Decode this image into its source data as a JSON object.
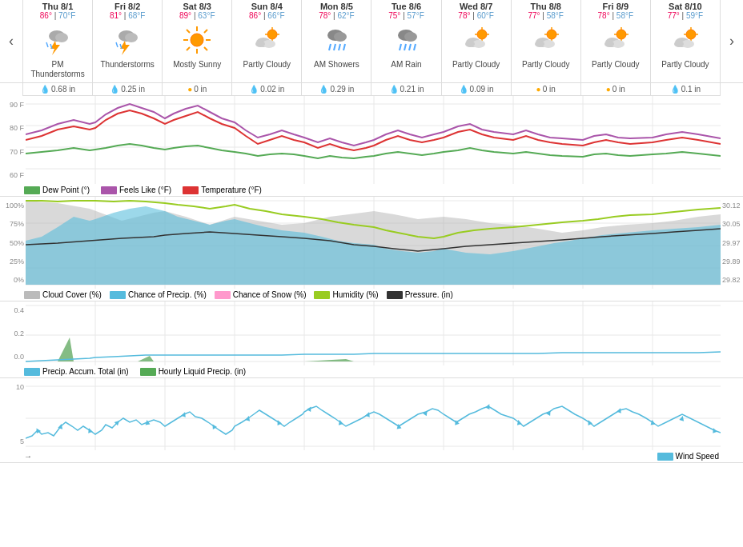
{
  "days": [
    {
      "name": "Thu 8/1",
      "high": "86°",
      "low": "70°F",
      "desc": "PM Thunderstorms",
      "icon": "thunder",
      "precip": "0.68 in",
      "precipType": "rain"
    },
    {
      "name": "Fri 8/2",
      "high": "81°",
      "low": "68°F",
      "desc": "Thunderstorms",
      "icon": "thunder",
      "precip": "0.25 in",
      "precipType": "rain"
    },
    {
      "name": "Sat 8/3",
      "high": "89°",
      "low": "63°F",
      "desc": "Mostly Sunny",
      "icon": "sun",
      "precip": "0 in",
      "precipType": "sun"
    },
    {
      "name": "Sun 8/4",
      "high": "86°",
      "low": "66°F",
      "desc": "Partly Cloudy",
      "icon": "cloud-sun",
      "precip": "0.02 in",
      "precipType": "rain"
    },
    {
      "name": "Mon 8/5",
      "high": "78°",
      "low": "62°F",
      "desc": "AM Showers",
      "icon": "rain",
      "precip": "0.29 in",
      "precipType": "rain"
    },
    {
      "name": "Tue 8/6",
      "high": "75°",
      "low": "57°F",
      "desc": "AM Rain",
      "icon": "rain",
      "precip": "0.21 in",
      "precipType": "rain"
    },
    {
      "name": "Wed 8/7",
      "high": "78°",
      "low": "60°F",
      "desc": "Partly Cloudy",
      "icon": "cloud-sun",
      "precip": "0.09 in",
      "precipType": "rain"
    },
    {
      "name": "Thu 8/8",
      "high": "77°",
      "low": "58°F",
      "desc": "Partly Cloudy",
      "icon": "cloud-sun",
      "precip": "0 in",
      "precipType": "sun"
    },
    {
      "name": "Fri 8/9",
      "high": "78°",
      "low": "58°F",
      "desc": "Partly Cloudy",
      "icon": "cloud-sun",
      "precip": "0 in",
      "precipType": "sun"
    },
    {
      "name": "Sat 8/10",
      "high": "77°",
      "low": "59°F",
      "desc": "Partly Cloudy",
      "icon": "cloud-sun",
      "precip": "0.1 in",
      "precipType": "rain"
    }
  ],
  "legends": {
    "temp": [
      {
        "label": "Dew Point (°)",
        "color": "#5a5"
      },
      {
        "label": "Feels Like (°F)",
        "color": "#a5a"
      },
      {
        "label": "Temperature (°F)",
        "color": "#d33"
      }
    ],
    "precip": [
      {
        "label": "Cloud Cover (%)",
        "color": "#bbb"
      },
      {
        "label": "Chance of Precip. (%)",
        "color": "#5bd"
      },
      {
        "label": "Chance of Snow (%)",
        "color": "#f9c"
      },
      {
        "label": "Humidity (%)",
        "color": "#9c2"
      },
      {
        "label": "Pressure. (in)",
        "color": "#333"
      }
    ],
    "accum": [
      {
        "label": "Precip. Accum. Total (in)",
        "color": "#5bd"
      },
      {
        "label": "Hourly Liquid Precip. (in)",
        "color": "#5a5"
      }
    ],
    "wind": [
      {
        "label": "Wind Speed",
        "color": "#5bd"
      }
    ]
  },
  "nav": {
    "prev": "‹",
    "next": "›"
  },
  "axis": {
    "temp_labels": [
      "90 F",
      "80 F",
      "70 F",
      "60 F"
    ],
    "pct_labels": [
      "100%",
      "75%",
      "50%",
      "25%",
      "0%"
    ],
    "pressure_labels": [
      "30.12",
      "30.05",
      "29.97",
      "29.89",
      "29.82"
    ],
    "accum_labels": [
      "0.4",
      "0.2",
      "0.0"
    ],
    "wind_labels": [
      "10",
      "5"
    ]
  }
}
